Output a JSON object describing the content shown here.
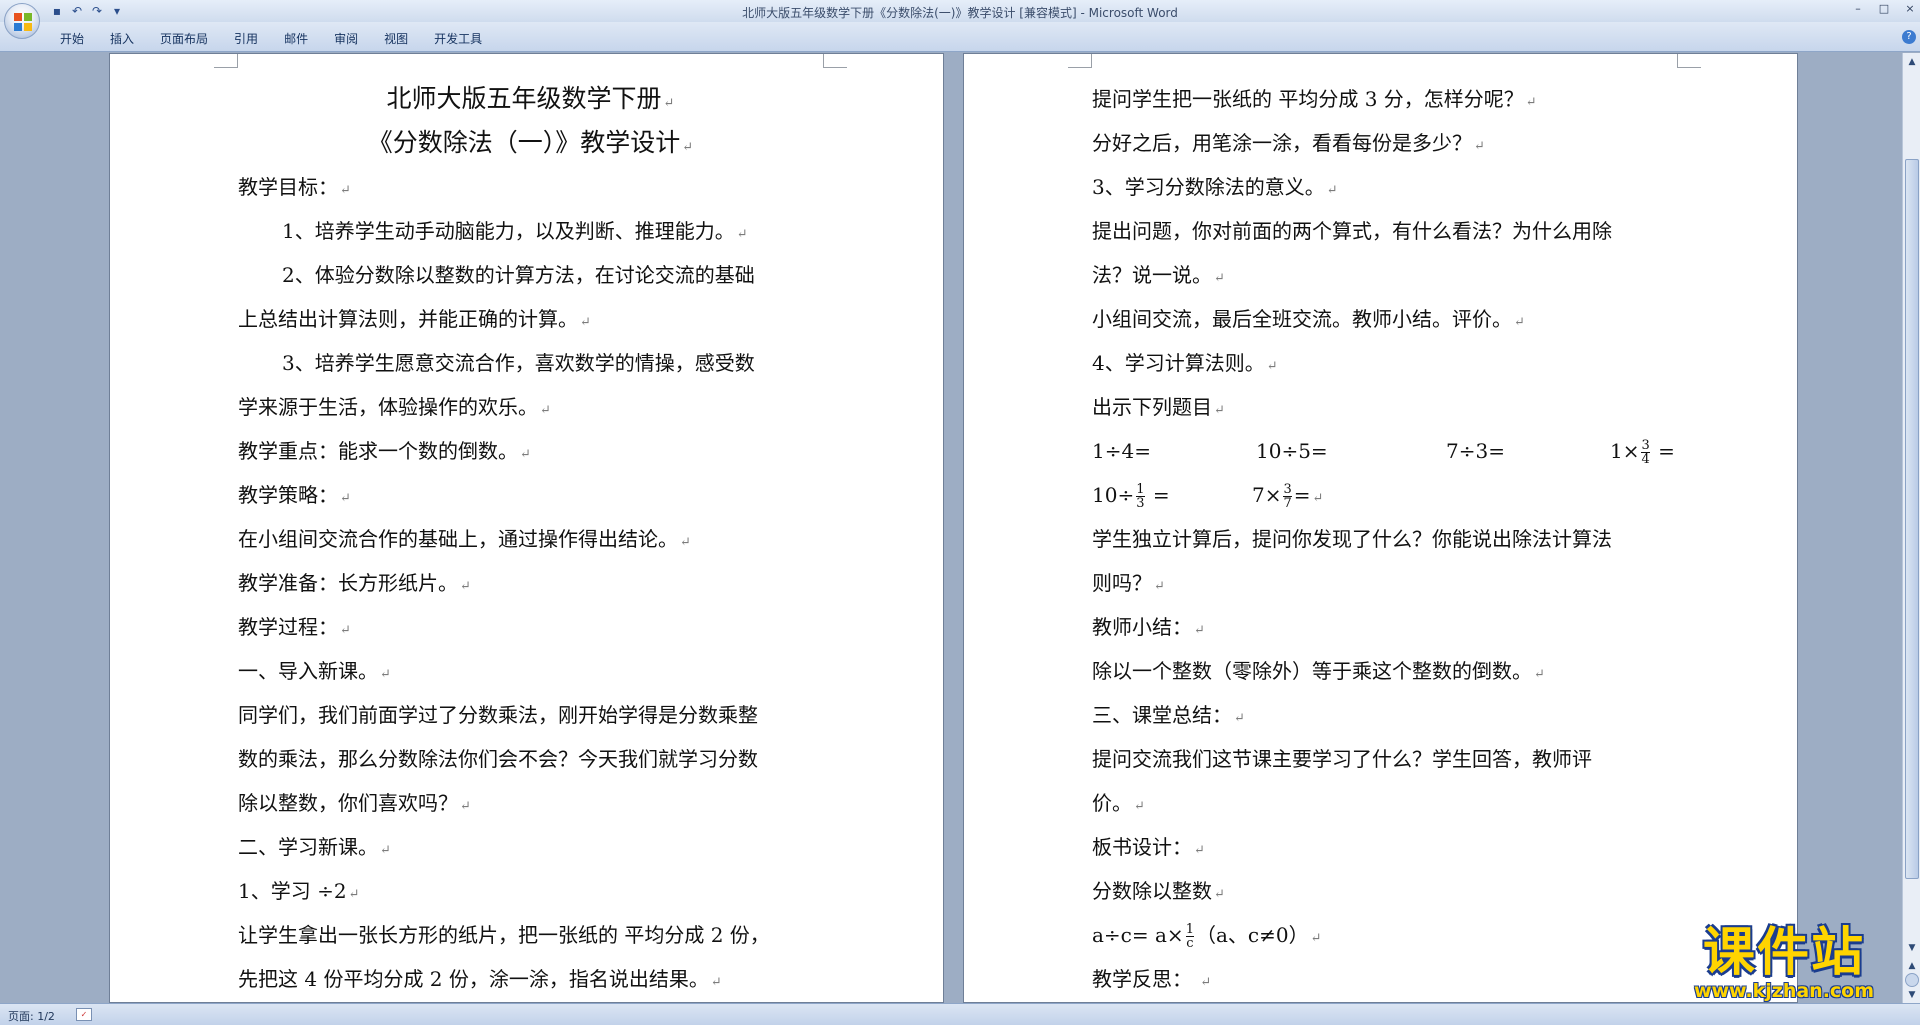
{
  "window": {
    "title": "北师大版五年级数学下册《分数除法(一)》教学设计 [兼容模式] - Microsoft Word",
    "controls": {
      "minimize": "–",
      "maximize": "□",
      "close": "×"
    }
  },
  "quick_access": {
    "save_icon": "save-icon",
    "undo_icon": "undo-icon",
    "redo_icon": "redo-icon",
    "customize": "▾"
  },
  "ribbon": {
    "tabs": [
      "开始",
      "插入",
      "页面布局",
      "引用",
      "邮件",
      "审阅",
      "视图",
      "开发工具"
    ],
    "help": "?"
  },
  "pilcrow": "↵",
  "left_page": {
    "title1": "北师大版五年级数学下册",
    "title2": "《分数除法（一）》教学设计",
    "lines": [
      "教学目标：",
      "1、培养学生动手动脑能力，以及判断、推理能力。",
      "2、体验分数除以整数的计算方法，在讨论交流的基础",
      "上总结出计算法则，并能正确的计算。",
      "3、培养学生愿意交流合作，喜欢数学的情操，感受数",
      "学来源于生活，体验操作的欢乐。",
      "教学重点：能求一个数的倒数。",
      "教学策略：",
      "在小组间交流合作的基础上，通过操作得出结论。",
      "教学准备：长方形纸片。",
      "教学过程：",
      "一、导入新课。",
      "同学们，我们前面学过了分数乘法，刚开始学得是分数乘整",
      "数的乘法，那么分数除法你们会不会？今天我们就学习分数",
      "除以整数，你们喜欢吗？",
      "二、学习新课。",
      "1、学习  ÷2",
      "让学生拿出一张长方形的纸片，把一张纸的  平均分成 2 份，",
      "先把这 4 份平均分成 2 份，涂一涂，指名说出结果。"
    ]
  },
  "right_page": {
    "lines_top": [
      "提问学生把一张纸的  平均分成 3 分，怎样分呢？",
      "分好之后，用笔涂一涂，看看每份是多少？",
      "3、学习分数除法的意义。",
      "提出问题，你对前面的两个算式，有什么看法？为什么用除",
      "法？说一说。",
      "小组间交流，最后全班交流。教师小结。评价。",
      "4、学习计算法则。",
      "出示下列题目"
    ],
    "math_row1": {
      "a": "1÷4=",
      "b": "10÷5=",
      "c": "7÷3=",
      "d_pre": "1×",
      "d_num": "3",
      "d_den": "4",
      "d_post": " ="
    },
    "math_row2": {
      "a_pre": "10÷",
      "a_num": "1",
      "a_den": "3",
      "a_post": " =",
      "b_pre": "7×",
      "b_num": "3",
      "b_den": "7",
      "b_post": "="
    },
    "lines_bottom": [
      "学生独立计算后，提问你发现了什么？你能说出除法计算法",
      "则吗？",
      "教师小结：",
      "除以一个整数（零除外）等于乘这个整数的倒数。",
      "三、课堂总结：",
      "提问交流我们这节课主要学习了什么？学生回答，教师评",
      "价。",
      "板书设计：",
      "分数除以整数"
    ],
    "formula": {
      "pre": "a÷c= a×",
      "num": "1",
      "den": "c",
      "post": "（a、c≠0）"
    },
    "last_line": "教学反思：  "
  },
  "status_bar": {
    "page_count": "页面: 1/2"
  },
  "watermark": {
    "text": "课件站",
    "url": "www.kjzhan.com"
  }
}
